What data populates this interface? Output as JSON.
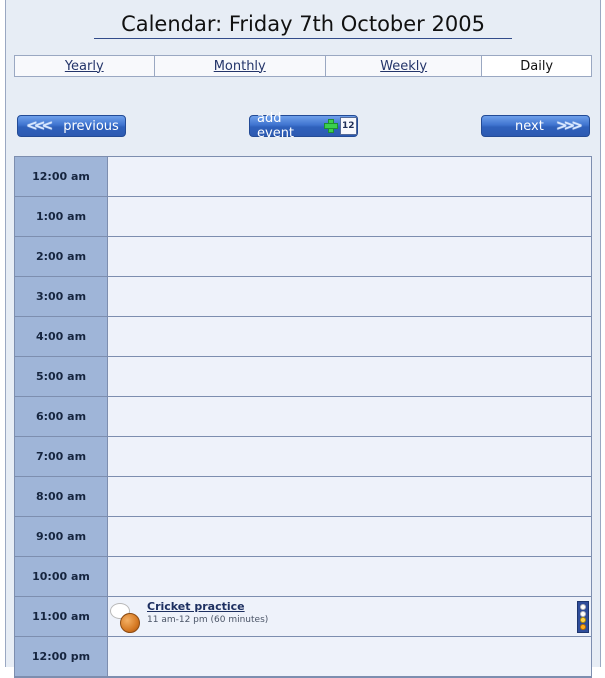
{
  "page": {
    "title": "Calendar: Friday 7th October 2005"
  },
  "tabs": [
    {
      "label": "Yearly"
    },
    {
      "label": "Monthly"
    },
    {
      "label": "Weekly"
    },
    {
      "label": "Daily"
    }
  ],
  "buttons": {
    "previous": "previous",
    "add_event": "add event",
    "next": "next",
    "calendar_icon_text": "12"
  },
  "hours": [
    {
      "time": "12:00 am"
    },
    {
      "time": "1:00 am"
    },
    {
      "time": "2:00 am"
    },
    {
      "time": "3:00 am"
    },
    {
      "time": "4:00 am"
    },
    {
      "time": "5:00 am"
    },
    {
      "time": "6:00 am"
    },
    {
      "time": "7:00 am"
    },
    {
      "time": "8:00 am"
    },
    {
      "time": "9:00 am"
    },
    {
      "time": "10:00 am"
    },
    {
      "time": "11:00 am"
    },
    {
      "time": "12:00 pm"
    }
  ],
  "event": {
    "title": "Cricket practice",
    "meta": "11 am-12 pm (60 minutes)"
  }
}
